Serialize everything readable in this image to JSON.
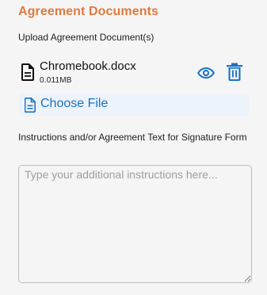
{
  "section": {
    "title": "Agreement Documents",
    "upload_label": "Upload Agreement Document(s)"
  },
  "file": {
    "name": "Chromebook.docx",
    "size": "0.011MB",
    "icon": "document-icon"
  },
  "actions": {
    "view_icon": "eye-icon",
    "delete_icon": "trash-icon"
  },
  "choose_file": {
    "label": "Choose File",
    "icon": "document-outline-icon"
  },
  "instructions": {
    "label": "Instructions and/or Agreement Text for Signature Form",
    "placeholder": "Type your additional instructions here...",
    "value": ""
  },
  "colors": {
    "accent": "#e07a3e",
    "link": "#1a73c8",
    "background": "#f5f5f5"
  }
}
